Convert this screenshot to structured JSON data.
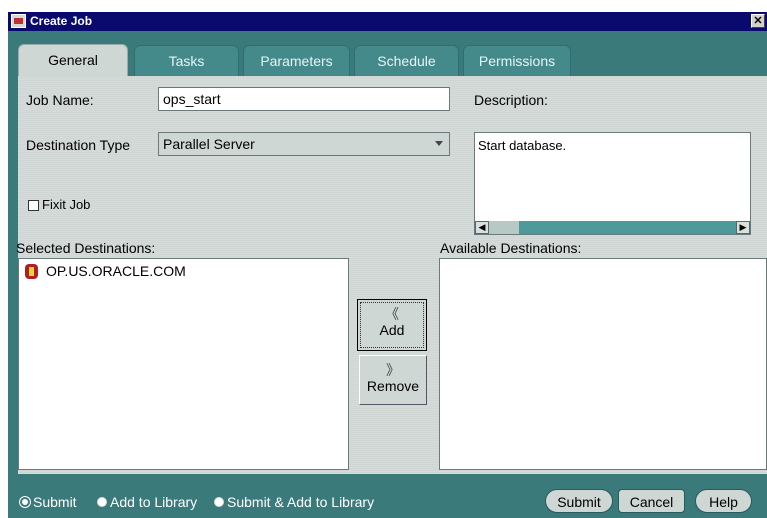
{
  "window": {
    "title": "Create Job",
    "close_glyph": "✕"
  },
  "tabs": [
    {
      "label": "General",
      "active": true
    },
    {
      "label": "Tasks",
      "active": false
    },
    {
      "label": "Parameters",
      "active": false
    },
    {
      "label": "Schedule",
      "active": false
    },
    {
      "label": "Permissions",
      "active": false
    }
  ],
  "general": {
    "job_name_label": "Job Name:",
    "job_name_value": "ops_start",
    "destination_type_label": "Destination Type",
    "destination_type_value": "Parallel Server",
    "description_label": "Description:",
    "description_value": "Start database.",
    "fixit_label": "Fixit Job",
    "fixit_checked": false,
    "selected_destinations_label": "Selected Destinations:",
    "selected_destinations": [
      "OP.US.ORACLE.COM"
    ],
    "available_destinations_label": "Available Destinations:",
    "available_destinations": [],
    "add_label": "Add",
    "add_chevron": "《",
    "remove_label": "Remove",
    "remove_chevron": "》"
  },
  "footer": {
    "radio_options": [
      {
        "label": "Submit",
        "selected": true
      },
      {
        "label": "Add to Library",
        "selected": false
      },
      {
        "label": "Submit & Add to Library",
        "selected": false
      }
    ],
    "submit_label": "Submit",
    "cancel_label": "Cancel",
    "help_label": "Help"
  },
  "colors": {
    "window_bg": "#3a7a7a",
    "title_bg": "#0a0a6e",
    "panel_bg": "#cfd6d3"
  }
}
